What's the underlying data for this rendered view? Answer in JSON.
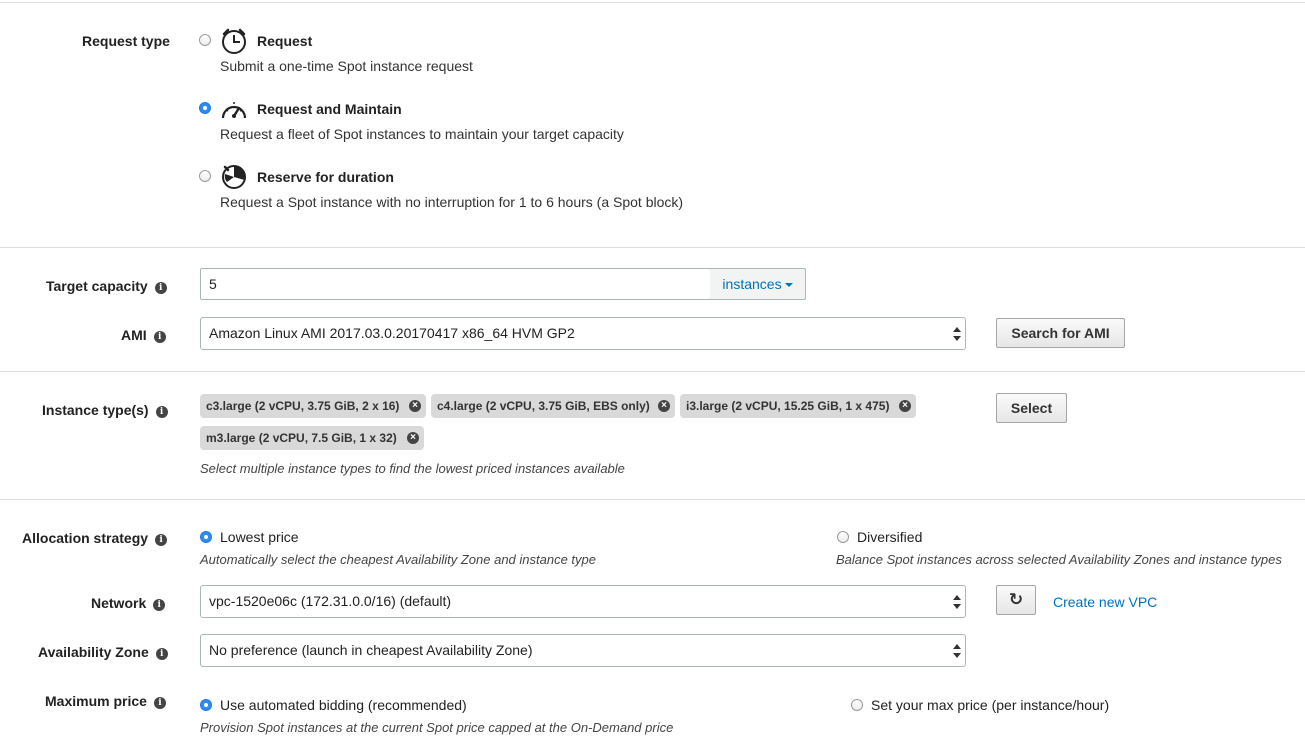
{
  "request_type": {
    "label": "Request type",
    "options": [
      {
        "title": "Request",
        "desc": "Submit a one-time Spot instance request",
        "selected": false,
        "icon": "clock-icon"
      },
      {
        "title": "Request and Maintain",
        "desc": "Request a fleet of Spot instances to maintain your target capacity",
        "selected": true,
        "icon": "gauge-icon"
      },
      {
        "title": "Reserve for duration",
        "desc": "Request a Spot instance with no interruption for 1 to 6 hours (a Spot block)",
        "selected": false,
        "icon": "timer-icon"
      }
    ]
  },
  "target_capacity": {
    "label": "Target capacity",
    "value": "5",
    "unit": "instances"
  },
  "ami": {
    "label": "AMI",
    "value": "Amazon Linux AMI 2017.03.0.20170417 x86_64 HVM GP2",
    "search_button": "Search for AMI"
  },
  "instance_types": {
    "label": "Instance type(s)",
    "tags": [
      "c3.large (2 vCPU, 3.75 GiB, 2 x 16)",
      "c4.large (2 vCPU, 3.75 GiB, EBS only)",
      "i3.large (2 vCPU, 15.25 GiB, 1 x 475)",
      "m3.large (2 vCPU, 7.5 GiB, 1 x 32)"
    ],
    "hint": "Select multiple instance types to find the lowest priced instances available",
    "select_button": "Select"
  },
  "allocation": {
    "label": "Allocation strategy",
    "options": [
      {
        "title": "Lowest price",
        "desc": "Automatically select the cheapest Availability Zone and instance type",
        "selected": true
      },
      {
        "title": "Diversified",
        "desc": "Balance Spot instances across selected Availability Zones and instance types",
        "selected": false
      }
    ]
  },
  "network": {
    "label": "Network",
    "value": "vpc-1520e06c (172.31.0.0/16) (default)",
    "create_link": "Create new VPC"
  },
  "az": {
    "label": "Availability Zone",
    "value": "No preference (launch in cheapest Availability Zone)"
  },
  "max_price": {
    "label": "Maximum price",
    "options": [
      {
        "title": "Use automated bidding (recommended)",
        "desc": "Provision Spot instances at the current Spot price capped at the On-Demand price",
        "selected": true
      },
      {
        "title": "Set your max price (per instance/hour)",
        "selected": false
      }
    ]
  },
  "info_glyph": "i",
  "remove_glyph": "×",
  "refresh_glyph": "↻",
  "accent_color": "#2d8cf0",
  "link_color": "#0073bb"
}
